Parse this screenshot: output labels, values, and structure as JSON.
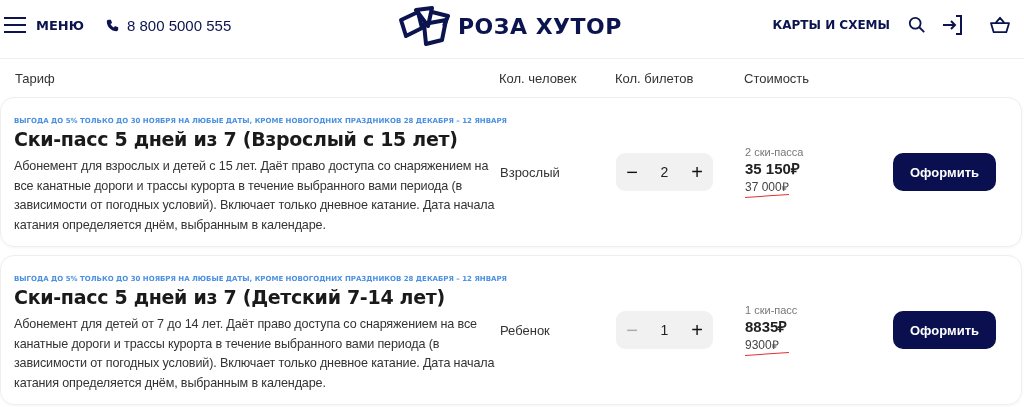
{
  "header": {
    "menu_label": "МЕНЮ",
    "phone": "8 800 5000 555",
    "logo_text": "РОЗА ХУТОР",
    "maps_link": "КАРТЫ И СХЕМЫ"
  },
  "columns": [
    "Тариф",
    "Кол. человек",
    "Кол. билетов",
    "Стоимость"
  ],
  "tariffs": [
    {
      "promo": "ВЫГОДА ДО 5% ТОЛЬКО ДО 30 НОЯБРЯ НА ЛЮБЫЕ ДАТЫ, КРОМЕ НОВОГОДНИХ ПРАЗДНИКОВ 28 ДЕКАБРЯ – 12 ЯНВАРЯ",
      "title": "Ски-пасс 5 дней из 7 (Взрослый с 15 лет)",
      "description": "Абонемент для взрослых и детей с 15 лет. Даёт право доступа со снаряжением на все канатные дороги и трассы курорта в течение выбранного вами периода (в зависимости от погодных условий). Включает только дневное катание. Дата начала катания определяется днём, выбранным в календаре.",
      "person_type": "Взрослый",
      "minus": "−",
      "count": "2",
      "plus": "+",
      "minus_disabled": false,
      "passes": "2 ски-пасса",
      "price": "35 150₽",
      "old_price": "37 000₽",
      "button": "Оформить"
    },
    {
      "promo": "ВЫГОДА ДО 5% ТОЛЬКО ДО 30 НОЯБРЯ НА ЛЮБЫЕ ДАТЫ, КРОМЕ НОВОГОДНИХ ПРАЗДНИКОВ 28 ДЕКАБРЯ – 12 ЯНВАРЯ",
      "title": "Ски-пасс 5 дней из 7 (Детский 7-14 лет)",
      "description": "Абонемент для детей от 7 до 14 лет. Даёт право доступа со снаряжением на все канатные дороги и трассы курорта в течение выбранного вами периода (в зависимости от погодных условий). Включает только дневное катание. Дата начала катания определяется днём, выбранным в календаре.",
      "person_type": "Ребенок",
      "minus": "−",
      "count": "1",
      "plus": "+",
      "minus_disabled": true,
      "passes": "1 ски-пасс",
      "price": "8835₽",
      "old_price": "9300₽",
      "button": "Оформить"
    }
  ]
}
